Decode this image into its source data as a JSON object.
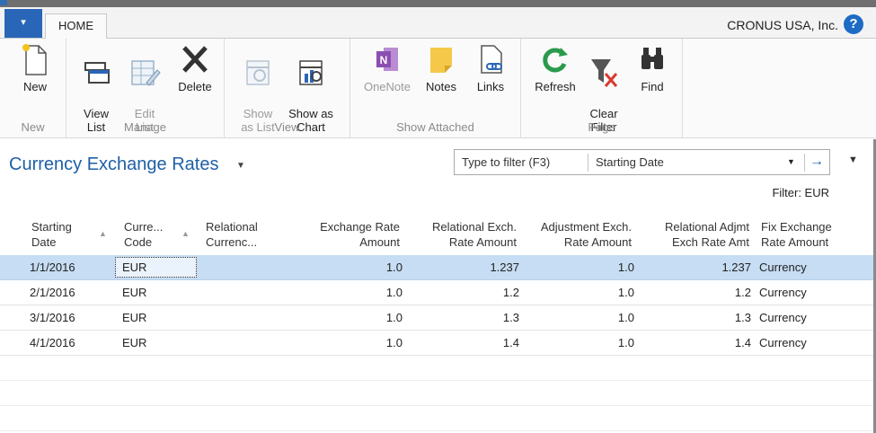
{
  "ribbon_tabs": {
    "file_label": "▾",
    "home_label": "HOME"
  },
  "company": "CRONUS USA, Inc.",
  "help_label": "?",
  "groups": {
    "new": {
      "label": "New",
      "buttons": {
        "new": "New"
      }
    },
    "manage": {
      "label": "Manage",
      "buttons": {
        "view_list": "View\nList",
        "edit_list": "Edit\nList",
        "delete": "Delete"
      }
    },
    "view": {
      "label": "View",
      "buttons": {
        "show_as_list": "Show\nas List",
        "show_as_chart": "Show as\nChart"
      }
    },
    "show_attached": {
      "label": "Show Attached",
      "buttons": {
        "onenote": "OneNote",
        "notes": "Notes",
        "links": "Links"
      }
    },
    "page": {
      "label": "Page",
      "buttons": {
        "refresh": "Refresh",
        "clear_filter": "Clear\nFilter",
        "find": "Find"
      }
    }
  },
  "page_title": "Currency Exchange Rates",
  "filter": {
    "placeholder": "Type to filter (F3)",
    "field": "Starting Date",
    "status": "Filter: EUR"
  },
  "columns": [
    {
      "label": "Starting\nDate"
    },
    {
      "label": "Curre...\nCode"
    },
    {
      "label": "Relational\nCurrenc..."
    },
    {
      "label": "Exchange Rate\nAmount"
    },
    {
      "label": "Relational Exch.\nRate Amount"
    },
    {
      "label": "Adjustment Exch.\nRate Amount"
    },
    {
      "label": "Relational Adjmt\nExch Rate Amt"
    },
    {
      "label": "Fix Exchange\nRate Amount"
    }
  ],
  "rows": [
    {
      "date": "1/1/2016",
      "code": "EUR",
      "rel": "",
      "amt": "1.0",
      "relamt": "1.237",
      "adj": "1.0",
      "reladj": "1.237",
      "fix": "Currency"
    },
    {
      "date": "2/1/2016",
      "code": "EUR",
      "rel": "",
      "amt": "1.0",
      "relamt": "1.2",
      "adj": "1.0",
      "reladj": "1.2",
      "fix": "Currency"
    },
    {
      "date": "3/1/2016",
      "code": "EUR",
      "rel": "",
      "amt": "1.0",
      "relamt": "1.3",
      "adj": "1.0",
      "reladj": "1.3",
      "fix": "Currency"
    },
    {
      "date": "4/1/2016",
      "code": "EUR",
      "rel": "",
      "amt": "1.0",
      "relamt": "1.4",
      "adj": "1.0",
      "reladj": "1.4",
      "fix": "Currency"
    }
  ],
  "colors": {
    "accent": "#1f5fa6",
    "selected_row": "#c6ddf3",
    "file_tab": "#2a66b8"
  }
}
